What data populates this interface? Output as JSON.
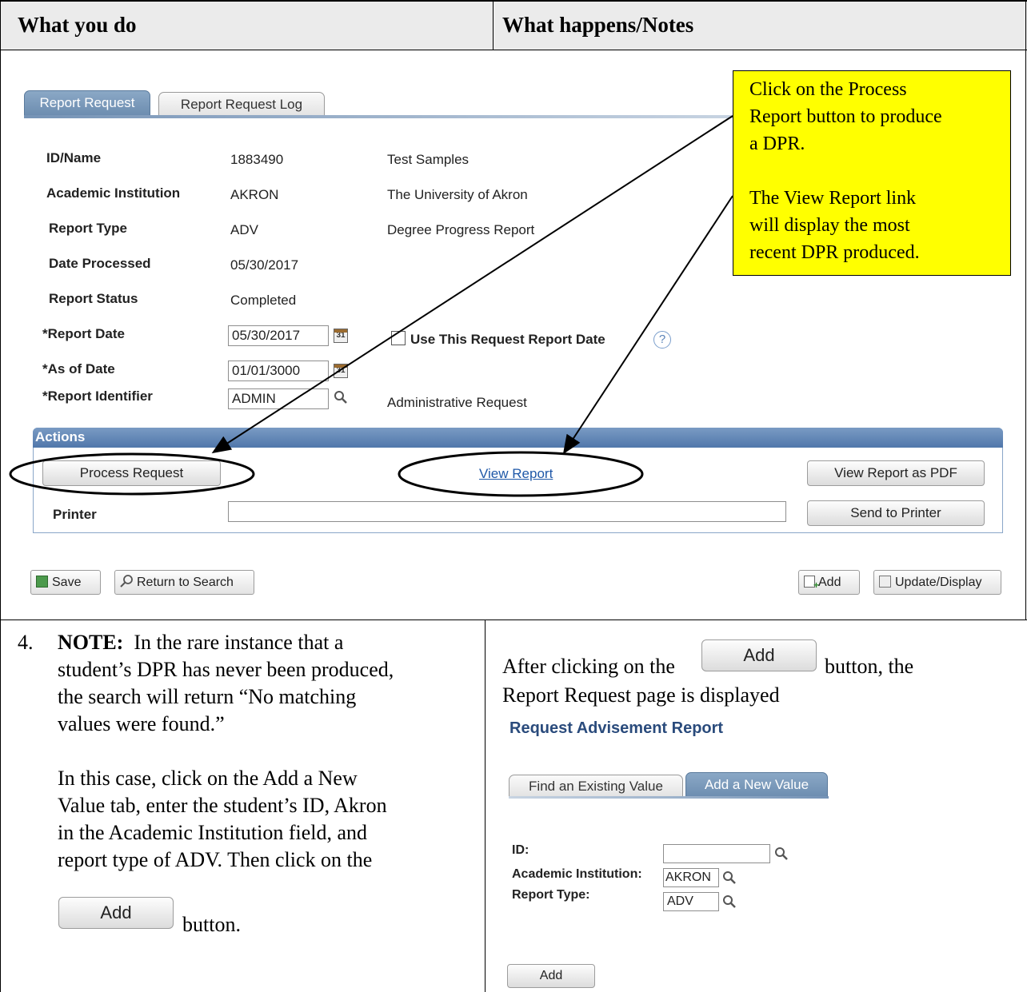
{
  "table": {
    "header_left": "What you do",
    "header_right": "What happens/Notes"
  },
  "report_request": {
    "tabs": [
      "Report Request",
      "Report Request Log"
    ],
    "fields": {
      "id_name_label": "ID/Name",
      "id_value": "1883490",
      "name_value": "Test Samples",
      "institution_label": "Academic Institution",
      "institution_value": "AKRON",
      "institution_desc": "The University of Akron",
      "report_type_label": "Report Type",
      "report_type_value": "ADV",
      "report_type_desc": "Degree Progress Report",
      "date_processed_label": "Date Processed",
      "date_processed_value": "05/30/2017",
      "report_status_label": "Report Status",
      "report_status_value": "Completed",
      "report_date_label": "*Report Date",
      "report_date_value": "05/30/2017",
      "use_request_date_label": "Use This Request Report Date",
      "as_of_date_label": "*As of Date",
      "as_of_date_value": "01/01/3000",
      "report_identifier_label": "*Report Identifier",
      "report_identifier_value": "ADMIN",
      "report_identifier_desc": "Administrative Request",
      "cal_glyph": "31",
      "help_glyph": "?"
    },
    "actions": {
      "header": "Actions",
      "process_request": "Process Request",
      "view_report": "View Report",
      "view_report_pdf": "View Report as PDF",
      "printer_label": "Printer",
      "send_to_printer": "Send to Printer"
    },
    "toolbar": {
      "save": "Save",
      "return_to_search": "Return to Search",
      "add": "Add",
      "update_display": "Update/Display"
    }
  },
  "callout": {
    "line1": "Click on the Process",
    "line2": "Report button to produce",
    "line3": "a DPR.",
    "line4": "The View Report link",
    "line5": "will display the most",
    "line6": "recent DPR produced."
  },
  "step4": {
    "number": "4.",
    "note_label": "NOTE:",
    "line1": "In the rare instance that a",
    "line2": "student’s DPR has never been produced,",
    "line3": "the search will return “No matching",
    "line4": "values were found.”",
    "line5": "In this case, click on the Add a New",
    "line6": "Value tab, enter the student’s ID, Akron",
    "line7": "in the Academic Institution field, and",
    "line8": "report type of ADV.  Then click on the",
    "add_button": "Add",
    "line9": "button."
  },
  "right_bottom": {
    "prefix": "After clicking on the",
    "add_button": "Add",
    "suffix": "button, the",
    "line2": "Report Request page is displayed",
    "page_title": "Request Advisement Report",
    "tab_find": "Find an Existing Value",
    "tab_add": "Add a New Value",
    "id_label": "ID:",
    "id_value": "",
    "institution_label": "Academic Institution:",
    "institution_value": "AKRON",
    "report_type_label": "Report Type:",
    "report_type_value": "ADV",
    "add_button_bottom": "Add"
  },
  "colors": {
    "callout_bg": "#ffff00",
    "header_bg": "#ebebeb",
    "actions_bar": "#5f85b5",
    "link": "#1f58a8",
    "title_blue": "#2a4b7c"
  }
}
